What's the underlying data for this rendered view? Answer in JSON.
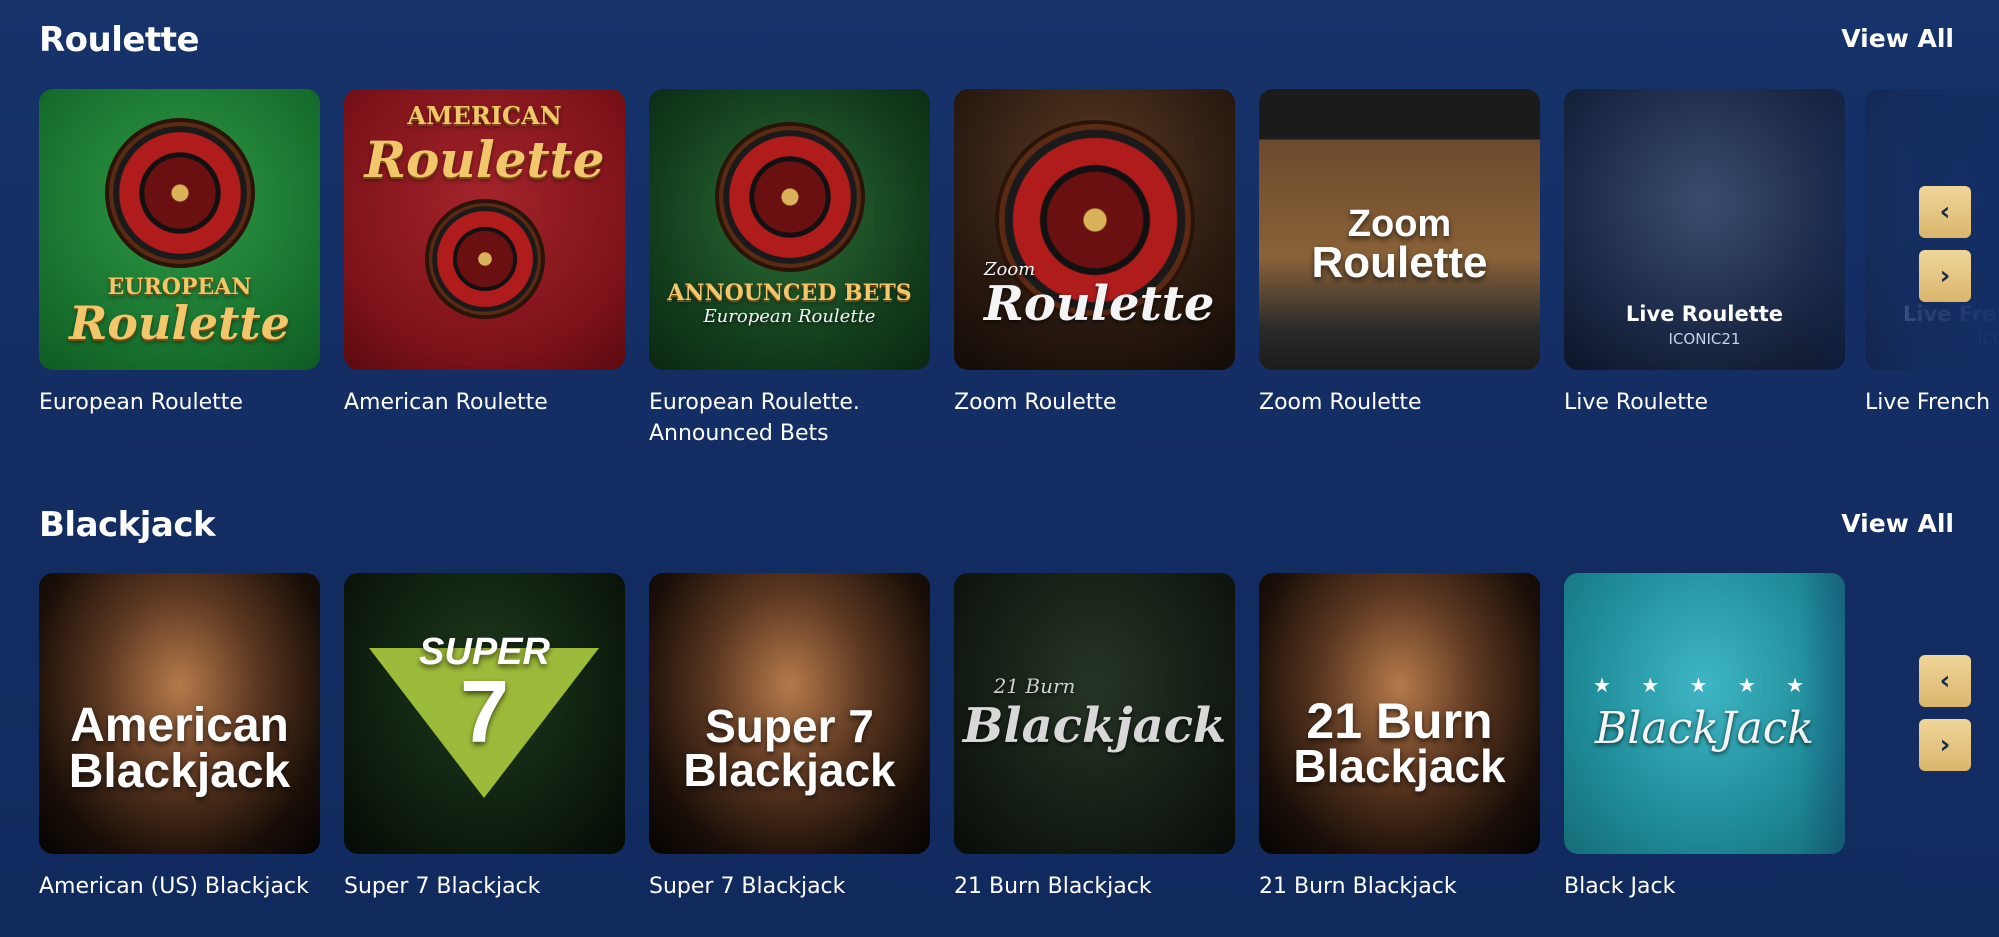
{
  "roulette": {
    "title": "Roulette",
    "view_all": "View All",
    "games": [
      {
        "label": "European Roulette",
        "art_line1": "EUROPEAN",
        "art_line2": "Roulette"
      },
      {
        "label": "American Roulette",
        "art_line1": "AMERICAN",
        "art_line2": "Roulette"
      },
      {
        "label": "European Roulette. Announced Bets",
        "art_line1": "ANNOUNCED BETS",
        "art_line2": "European Roulette"
      },
      {
        "label": "Zoom Roulette",
        "art_line1": "Zoom",
        "art_line2": "Roulette"
      },
      {
        "label": "Zoom Roulette",
        "art_line1": "Zoom",
        "art_line2": "Roulette"
      },
      {
        "label": "Live Roulette",
        "art_line1": "Live Roulette",
        "art_line2": "ICONIC21"
      },
      {
        "label": "Live French R",
        "art_line1": "Live Fren",
        "art_line2": "ICO"
      }
    ]
  },
  "blackjack": {
    "title": "Blackjack",
    "view_all": "View All",
    "games": [
      {
        "label": "American (US) Blackjack",
        "art_line1": "American",
        "art_line2": "Blackjack"
      },
      {
        "label": "Super 7 Blackjack",
        "art_line1": "SUPER",
        "art_line2": "7"
      },
      {
        "label": "Super 7 Blackjack",
        "art_line1": "Super 7",
        "art_line2": "Blackjack"
      },
      {
        "label": "21 Burn Blackjack",
        "art_line1": "21 Burn",
        "art_line2": "Blackjack"
      },
      {
        "label": "21 Burn Blackjack",
        "art_line1": "21 Burn",
        "art_line2": "Blackjack"
      },
      {
        "label": "Black Jack",
        "art_line1": "★ ★ ★ ★ ★",
        "art_line2": "BlackJack"
      }
    ]
  },
  "icons": {
    "prev": "‹",
    "next": "›"
  },
  "colors": {
    "background": "#132d63",
    "arrow_button": "#e3c27d"
  }
}
